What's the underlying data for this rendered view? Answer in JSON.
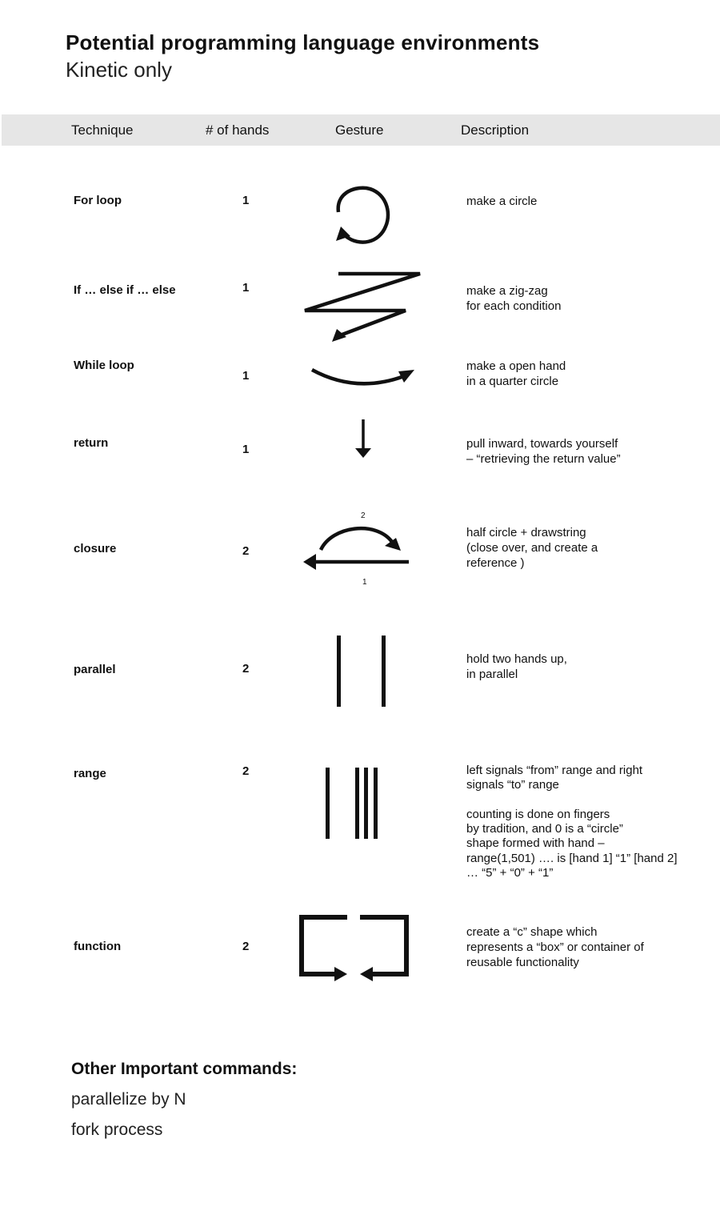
{
  "header": {
    "title": "Potential programming language environments",
    "subtitle": "Kinetic only"
  },
  "table": {
    "columns": [
      "Technique",
      "# of hands",
      "Gesture",
      "Description"
    ],
    "rows": [
      {
        "technique": "For loop",
        "hands": "1",
        "gesture": "circle-arrow-icon",
        "description": "make a circle"
      },
      {
        "technique": "If … else if … else",
        "hands": "1",
        "gesture": "zigzag-arrow-icon",
        "description": "make a zig-zag\nfor each condition"
      },
      {
        "technique": "While loop",
        "hands": "1",
        "gesture": "quarter-arc-arrow-icon",
        "description": "make a open hand\nin a quarter circle"
      },
      {
        "technique": "return",
        "hands": "1",
        "gesture": "down-arrow-icon",
        "description": "pull inward, towards yourself\n– “retrieving the return value”"
      },
      {
        "technique": "closure",
        "hands": "2",
        "gesture": "half-circle-drawstring-icon",
        "gesture_labels": [
          "2",
          "1"
        ],
        "description": "half circle + drawstring\n(close over, and create a\nreference )"
      },
      {
        "technique": "parallel",
        "hands": "2",
        "gesture": "two-parallel-lines-icon",
        "description": "hold two hands up,\nin parallel"
      },
      {
        "technique": "range",
        "hands": "2",
        "gesture": "range-lines-icon",
        "description": "left signals “from” range and right\nsignals “to” range\n\ncounting is done on fingers\nby tradition, and 0 is a “circle”\nshape formed with hand –\nrange(1,501) …. is [hand 1] “1” [hand 2]\n… “5” + “0” + “1”"
      },
      {
        "technique": "function",
        "hands": "2",
        "gesture": "c-shape-box-arrows-icon",
        "description": "create a “c” shape which\nrepresents a “box” or container of\nreusable functionality"
      }
    ]
  },
  "other": {
    "title": "Other Important commands:",
    "items": [
      "parallelize by N",
      "fork process"
    ]
  },
  "colors": {
    "header_bar": "#e6e6e6",
    "ink": "#111111"
  }
}
